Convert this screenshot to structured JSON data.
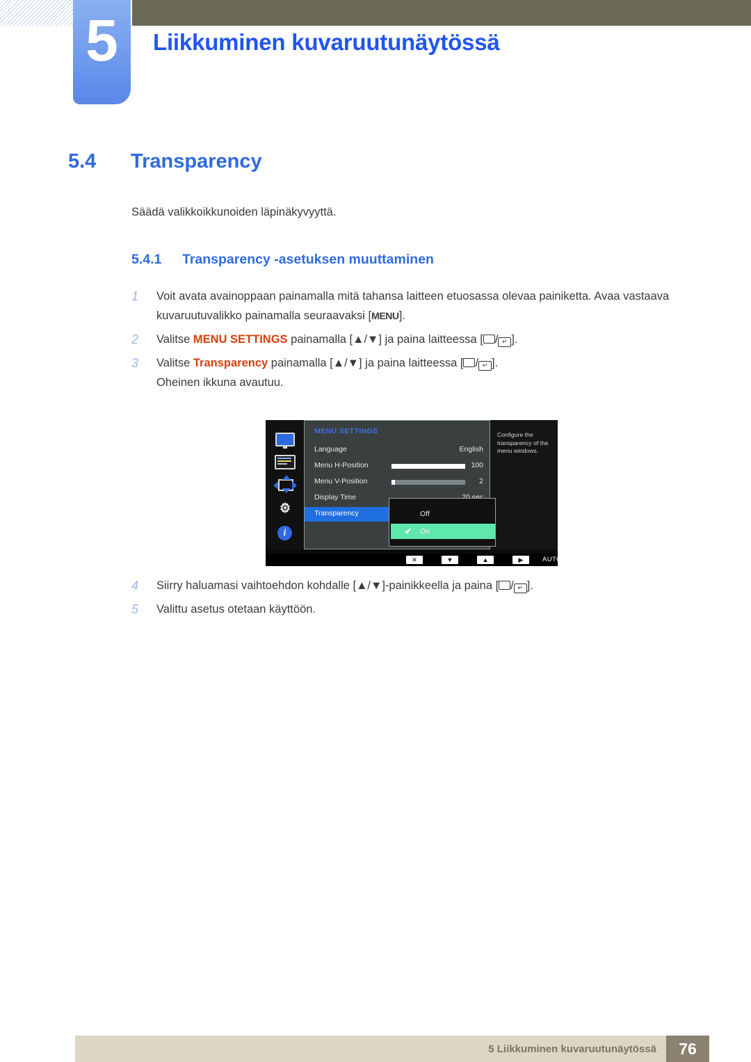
{
  "header": {
    "chapter_number": "5",
    "chapter_title": "Liikkuminen kuvaruutunäytössä",
    "tab_color": "#6f9bee",
    "bar_color": "#6b6a57",
    "title_color": "#2255ee"
  },
  "section": {
    "number": "5.4",
    "title": "Transparency",
    "intro": "Säädä valikkoikkunoiden läpinäkyvyyttä.",
    "sub_number": "5.4.1",
    "sub_title": "Transparency -asetuksen muuttaminen",
    "heading_color": "#2f6ae0"
  },
  "steps": [
    {
      "num": "1",
      "pre": "Voit avata avainoppaan painamalla mitä tahansa laitteen etuosassa olevaa painiketta. Avaa vastaava kuvaruutuvalikko painamalla seuraavaksi [",
      "key": "MENU",
      "post": "]."
    },
    {
      "num": "2",
      "pre": "Valitse ",
      "emph": "MENU SETTINGS",
      "mid": " painamalla [▲/▼] ja paina laitteessa [",
      "post": "]."
    },
    {
      "num": "3",
      "pre": "Valitse ",
      "emph": "Transparency",
      "mid": " painamalla [▲/▼] ja paina laitteessa [",
      "post": "].",
      "extra": "Oheinen ikkuna avautuu."
    },
    {
      "num": "4",
      "pre": "Siirry haluamasi vaihtoehdon kohdalle [▲/▼]-painikkeella ja paina [",
      "post": "]."
    },
    {
      "num": "5",
      "pre": "Valittu asetus otetaan käyttöön."
    }
  ],
  "osd": {
    "menu_title": "MENU SETTINGS",
    "title_color": "#3c6fe8",
    "highlight_color": "#1f6fe0",
    "selected_color": "#5fe8ac",
    "sidebar_icons": [
      "monitor-icon",
      "picture-list-icon",
      "position-arrows-icon",
      "gear-icon",
      "info-icon"
    ],
    "rows": [
      {
        "label": "Language",
        "value": "English",
        "slider": null,
        "selected": false
      },
      {
        "label": "Menu H-Position",
        "value": "100",
        "slider": 100,
        "selected": false
      },
      {
        "label": "Menu V-Position",
        "value": "2",
        "slider": 4,
        "selected": false
      },
      {
        "label": "Display Time",
        "value": "20 sec",
        "slider": null,
        "selected": false
      },
      {
        "label": "Transparency",
        "value": "",
        "slider": null,
        "selected": true
      }
    ],
    "dropdown": {
      "options": [
        {
          "label": "Off",
          "checked": false
        },
        {
          "label": "On",
          "checked": true
        }
      ],
      "check_glyph": "✔"
    },
    "tooltip": "Configure the transparency of the menu windows.",
    "bottom_bar": {
      "buttons": [
        "✕",
        "▼",
        "▲",
        "▶"
      ],
      "auto_label": "AUTO",
      "power_glyph": "⏻"
    }
  },
  "footer": {
    "text": "5 Liikkuminen kuvaruutunäytössä",
    "page": "76",
    "bar_color": "#dcd7c4",
    "page_box_color": "#8c8070"
  }
}
